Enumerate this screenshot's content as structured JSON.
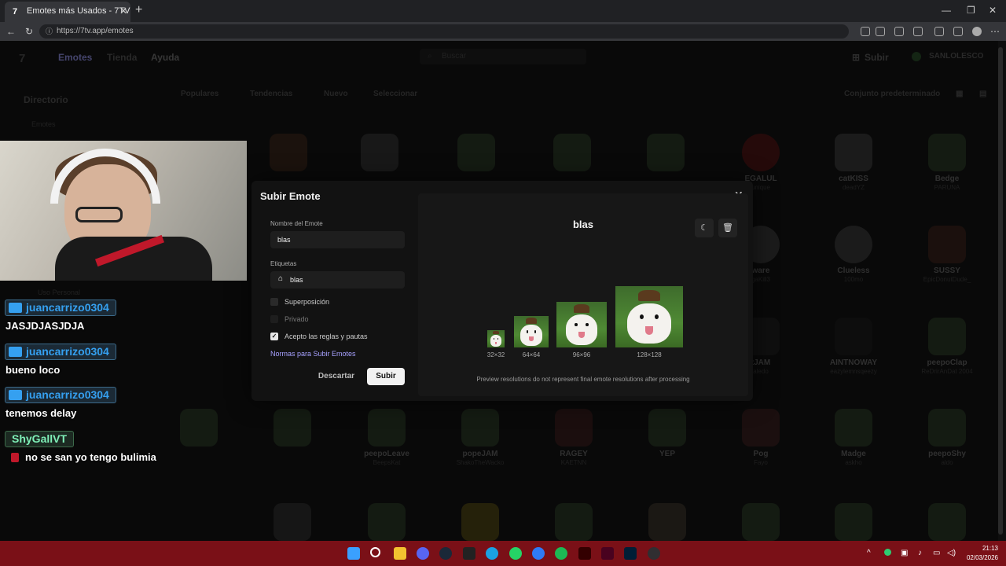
{
  "browser": {
    "tab_title": "Emotes más Usados - 7TV",
    "tab_favicon": "7",
    "url": "https://7tv.app/emotes"
  },
  "site": {
    "nav": [
      "Emotes",
      "Tienda",
      "Ayuda"
    ],
    "search_placeholder": "Buscar",
    "upload_label": "Subir",
    "username": "SANLOLESCO",
    "sidebar_title": "Directorio",
    "sidebar_item": "Emotes",
    "sidebar_item2": "Uso Personal",
    "filters": [
      "Populares",
      "Tendencias",
      "Nuevo",
      "Seleccionar"
    ],
    "set_label": "Conjunto predeterminado"
  },
  "emotes_row1": [
    {
      "name": "EGALUL",
      "by": "unique"
    },
    {
      "name": "catKISS",
      "by": "deadYZ"
    },
    {
      "name": "Bedge",
      "by": "PARUNA"
    }
  ],
  "emotes_row2": [
    {
      "name": "ware",
      "by": "gaKill3"
    },
    {
      "name": "Clueless",
      "by": "100mo"
    },
    {
      "name": "SUSSY",
      "by": "EpicDonutDude_"
    }
  ],
  "emotes_row3": [
    {
      "name": "tJAM",
      "by": "aledo"
    },
    {
      "name": "AINTNOWAY",
      "by": "eazylemnsqeezy"
    },
    {
      "name": "peepoClap",
      "by": "ReDrirAnDat 2004"
    }
  ],
  "emotes_row4": [
    {
      "name": "peepoLeave",
      "by": "BeepsKat"
    },
    {
      "name": "popeJAM",
      "by": "ShakoTheWacko"
    },
    {
      "name": "RAGEY",
      "by": "KAETNN"
    },
    {
      "name": "YEP",
      "by": ""
    },
    {
      "name": "Pog",
      "by": "Fayo"
    },
    {
      "name": "Madge",
      "by": "askho"
    },
    {
      "name": "peepoShy",
      "by": "aldo"
    }
  ],
  "modal": {
    "title": "Subir Emote",
    "name_label": "Nombre del Emote",
    "name_value": "blas",
    "tags_label": "Etiquetas",
    "tag_value": "blas",
    "overlay_label": "Superposición",
    "private_label": "Privado",
    "accept_label": "Acepto las reglas y pautas",
    "rules_link": "Normas para Subir Emotes",
    "discard": "Descartar",
    "submit": "Subir",
    "preview_name": "blas",
    "resolutions": [
      "32×32",
      "64×64",
      "96×96",
      "128×128"
    ],
    "preview_note": "Preview resolutions do not represent final emote resolutions after processing"
  },
  "chat": [
    {
      "user": "juancarrizo0304",
      "msg": "JASJDJASJDJA"
    },
    {
      "user": "juancarrizo0304",
      "msg": "bueno loco"
    },
    {
      "user": "juancarrizo0304",
      "msg": "tenemos delay"
    },
    {
      "user": "ShyGallVT",
      "msg": "no se san yo tengo bulimia"
    }
  ],
  "clock": {
    "time": "21:13",
    "date": "02/03/2026"
  },
  "colors": {
    "accent": "#a7a1ff",
    "taskbar": "#7a1017",
    "chat_user": "#35a0f0"
  }
}
